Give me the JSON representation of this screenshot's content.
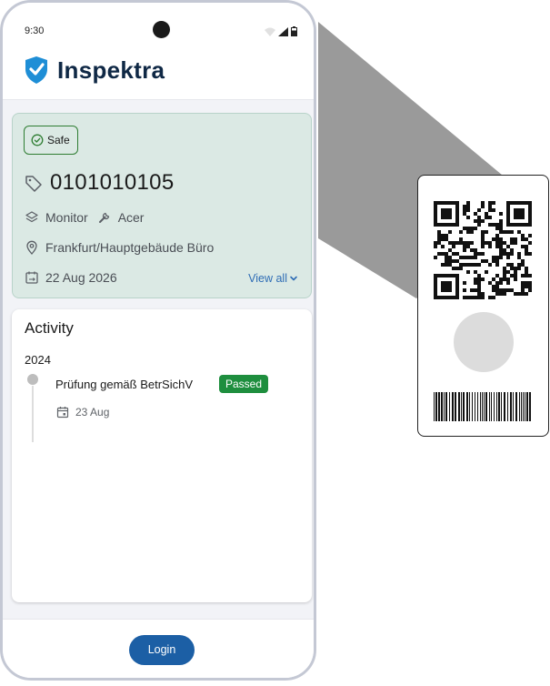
{
  "status_bar": {
    "time": "9:30"
  },
  "header": {
    "brand": "Inspektra",
    "brand_color": "#0f2845",
    "shield_color": "#1e8ed6"
  },
  "asset": {
    "status": "Safe",
    "status_color": "#2e7d32",
    "id": "0101010105",
    "type": "Monitor",
    "manufacturer": "Acer",
    "location": "Frankfurt/Hauptgebäude Büro",
    "next_date": "22 Aug 2026",
    "view_all_label": "View all",
    "card_color": "#dbe9e4"
  },
  "activity": {
    "title": "Activity",
    "groups": [
      {
        "year": "2024",
        "items": [
          {
            "name": "Prüfung gemäß BetrSichV",
            "result": "Passed",
            "date": "23 Aug"
          }
        ]
      }
    ]
  },
  "footer": {
    "login_label": "Login",
    "button_color": "#1c5fa5"
  },
  "icons": [
    "wifi-icon",
    "signal-icon",
    "battery-icon",
    "shield-check-icon",
    "check-circle-icon",
    "tag-icon",
    "layers-icon",
    "wrench-icon",
    "location-pin-icon",
    "calendar-repeat-icon",
    "chevron-down-icon",
    "calendar-icon",
    "qr-code",
    "barcode"
  ]
}
